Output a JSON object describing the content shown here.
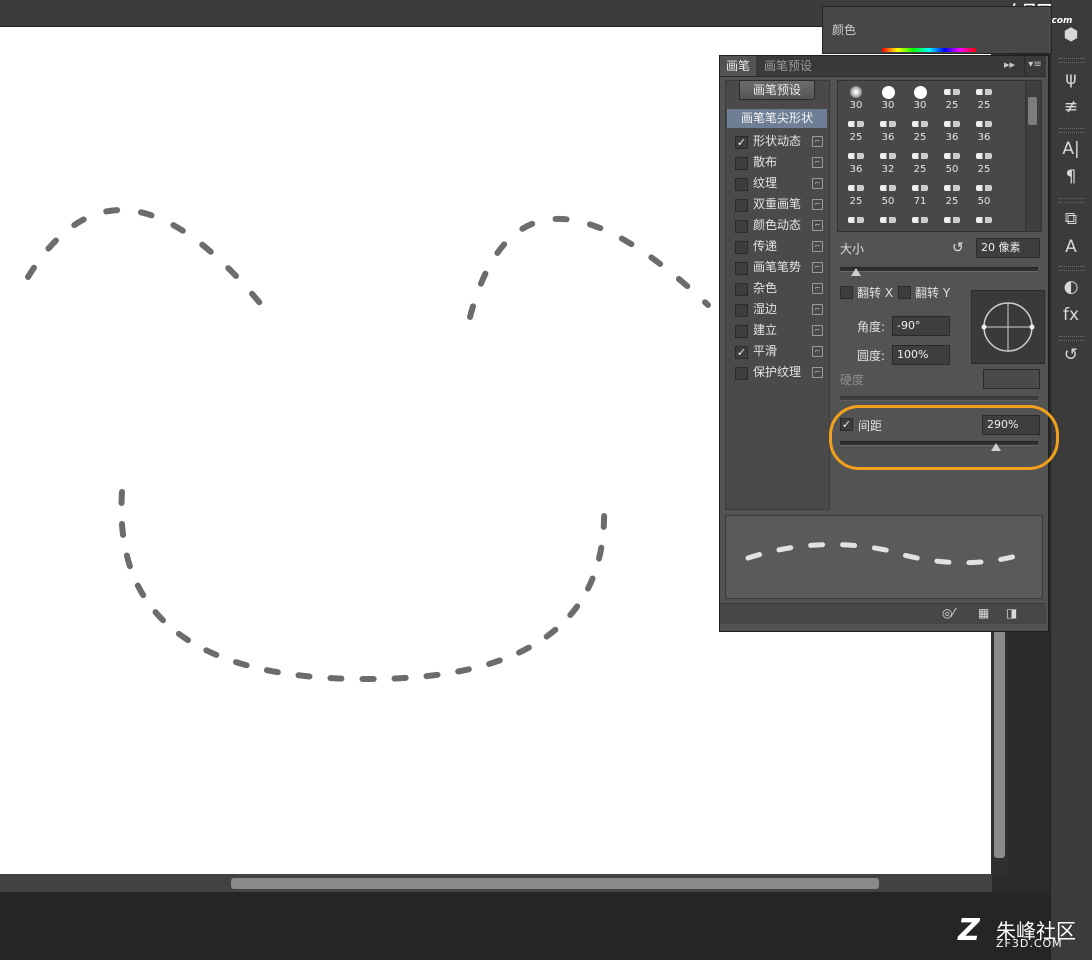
{
  "watermarks": {
    "top_brand": "火星网",
    "top_site": "hxsd.com",
    "bottom_brand": "朱峰社区",
    "bottom_site": "ZF3D.COM"
  },
  "color_panel": {
    "tab": "颜色"
  },
  "brush_panel": {
    "tabs": [
      "画笔",
      "画笔预设"
    ],
    "preset_button": "画笔预设",
    "tip_shape": "画笔笔尖形状",
    "options": [
      {
        "label": "形状动态",
        "checked": true
      },
      {
        "label": "散布",
        "checked": false
      },
      {
        "label": "纹理",
        "checked": false
      },
      {
        "label": "双重画笔",
        "checked": false
      },
      {
        "label": "颜色动态",
        "checked": false
      },
      {
        "label": "传递",
        "checked": false
      },
      {
        "label": "画笔笔势",
        "checked": false
      },
      {
        "label": "杂色",
        "checked": false
      },
      {
        "label": "湿边",
        "checked": false
      },
      {
        "label": "建立",
        "checked": false
      },
      {
        "label": "平滑",
        "checked": true
      },
      {
        "label": "保护纹理",
        "checked": false
      }
    ],
    "brush_sizes": [
      [
        "30",
        "30",
        "30",
        "25",
        "25"
      ],
      [
        "25",
        "36",
        "25",
        "36",
        "36"
      ],
      [
        "36",
        "32",
        "25",
        "50",
        "25"
      ],
      [
        "25",
        "50",
        "71",
        "25",
        "50"
      ]
    ],
    "size_label": "大小",
    "size_value": "20 像素",
    "size_fraction": 0.04,
    "flip_x": "翻转 X",
    "flip_y": "翻转 Y",
    "angle_label": "角度:",
    "angle_value": "-90°",
    "roundness_label": "圆度:",
    "roundness_value": "100%",
    "hardness_label": "硬度",
    "spacing_label": "间距",
    "spacing_checked": true,
    "spacing_value": "290%",
    "spacing_fraction": 0.79
  }
}
